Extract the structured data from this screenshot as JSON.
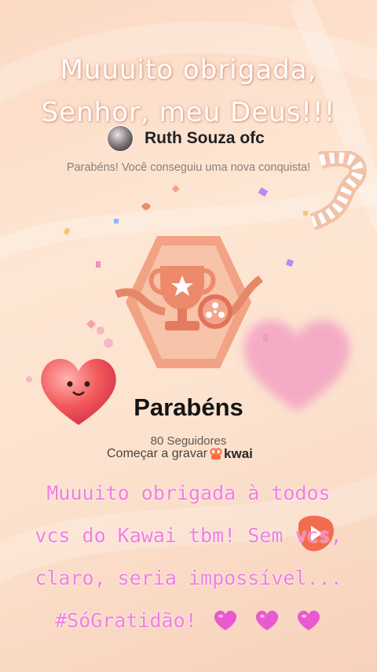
{
  "top_caption": {
    "line1": "Muuuito obrigada,",
    "line2": "Senhor, meu Deus!!!"
  },
  "user": {
    "name": "Ruth Souza ofc"
  },
  "achievement": {
    "message": "Parabéns! Você conseguiu uma nova conquista!",
    "title": "Parabéns",
    "followers": "80 Seguidores",
    "record_prompt": "Começar a gravar",
    "brand": "kwai"
  },
  "pink_caption": {
    "line1": "Muuuito obrigada à todos",
    "line2": "vcs do Kawai tbm! Sem vcs,",
    "line3": "claro, seria impossível...",
    "line4": "#SóGratidão!"
  },
  "colors": {
    "pink_text": "#f07de0",
    "brand_orange": "#ff6a3d",
    "badge": "#e98768"
  }
}
